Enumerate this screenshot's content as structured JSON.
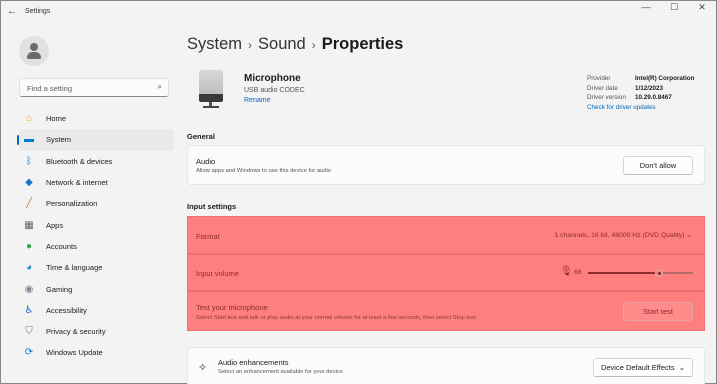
{
  "window": {
    "title": "Settings",
    "back_glyph": "←",
    "controls": {
      "minimize": "—",
      "maximize": "☐",
      "close": "✕"
    }
  },
  "sidebar": {
    "search_placeholder": "Find a setting",
    "search_icon": "⌕",
    "items": [
      {
        "label": "Home",
        "icon": "home-icon",
        "glyph": "⌂",
        "color": "#e8a33a"
      },
      {
        "label": "System",
        "icon": "system-icon",
        "glyph": "▬",
        "color": "#0078d4",
        "active": true
      },
      {
        "label": "Bluetooth & devices",
        "icon": "bluetooth-icon",
        "glyph": "ᛒ",
        "color": "#0078d4"
      },
      {
        "label": "Network & internet",
        "icon": "network-icon",
        "glyph": "◆",
        "color": "#1a73c7"
      },
      {
        "label": "Personalization",
        "icon": "brush-icon",
        "glyph": "╱",
        "color": "#d07a2c"
      },
      {
        "label": "Apps",
        "icon": "apps-icon",
        "glyph": "▦",
        "color": "#5a6470"
      },
      {
        "label": "Accounts",
        "icon": "accounts-icon",
        "glyph": "●",
        "color": "#2fa84f"
      },
      {
        "label": "Time & language",
        "icon": "globe-clock-icon",
        "glyph": "◕",
        "color": "#1a8fd6"
      },
      {
        "label": "Gaming",
        "icon": "gamepad-icon",
        "glyph": "◉",
        "color": "#7a8793"
      },
      {
        "label": "Accessibility",
        "icon": "accessibility-icon",
        "glyph": "♿",
        "color": "#1565c0"
      },
      {
        "label": "Privacy & security",
        "icon": "shield-icon",
        "glyph": "⛉",
        "color": "#6b7682"
      },
      {
        "label": "Windows Update",
        "icon": "update-icon",
        "glyph": "⟳",
        "color": "#0078d4"
      }
    ]
  },
  "breadcrumb": {
    "part1": "System",
    "sep1": "›",
    "part2": "Sound",
    "sep2": "›",
    "current": "Properties"
  },
  "device": {
    "name": "Microphone",
    "subtitle": "USB audio CODEC",
    "rename": "Rename",
    "driver": {
      "provider_label": "Provider",
      "provider": "Intel(R) Corporation",
      "date_label": "Driver date",
      "date": "1/12/2023",
      "version_label": "Driver version",
      "version": "10.29.0.8467",
      "check_link": "Check for driver updates"
    }
  },
  "general": {
    "heading": "General",
    "audio_title": "Audio",
    "audio_desc": "Allow apps and Windows to use this device for audio",
    "audio_button": "Don't allow"
  },
  "input_settings": {
    "heading": "Input settings",
    "format_label": "Format",
    "format_value": "1 channels, 16 bit, 48000 Hz (DVD Quality)",
    "format_chevron": "⌄",
    "volume_label": "Input volume",
    "volume_value": "68",
    "volume_level": 0.68,
    "volume_icon": "🎙",
    "test_title": "Test your microphone",
    "test_desc": "Select Start test and talk or play audio at your normal volume for at least a few seconds, then select Stop test",
    "test_button": "Start test",
    "highlight_color": "#ff7e7e"
  },
  "enhancements": {
    "title": "Audio enhancements",
    "desc": "Select an enhancement available for your device",
    "icon": "sparkle-icon",
    "glyph": "✧",
    "dropdown": "Device Default Effects",
    "chevron": "⌄"
  }
}
